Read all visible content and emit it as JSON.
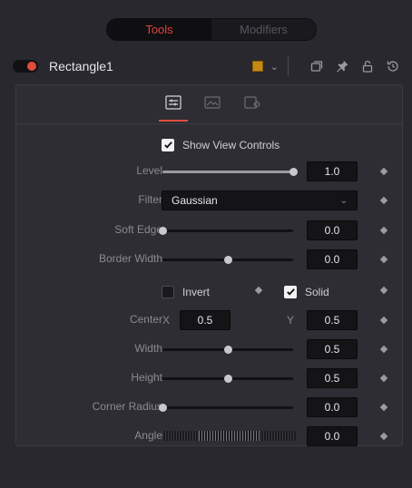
{
  "tabs": {
    "tools": "Tools",
    "modifiers": "Modifiers"
  },
  "tool": {
    "name": "Rectangle1",
    "color": "#c58a14"
  },
  "icons": {
    "header": [
      "copy-icon",
      "pin-icon",
      "lock-icon",
      "reset-icon"
    ],
    "subtabs": [
      "controls-icon",
      "image-icon",
      "settings-icon"
    ]
  },
  "controls": {
    "show_view_controls": "Show View Controls",
    "level": {
      "label": "Level",
      "value": "1.0",
      "fraction": 1.0
    },
    "filter": {
      "label": "Filter",
      "value": "Gaussian"
    },
    "soft_edge": {
      "label": "Soft Edge",
      "value": "0.0",
      "fraction": 0.0
    },
    "border_width": {
      "label": "Border Width",
      "value": "0.0",
      "fraction": 0.5
    },
    "invert": "Invert",
    "solid": "Solid",
    "center": {
      "label": "Center",
      "x_label": "X",
      "x_value": "0.5",
      "y_label": "Y",
      "y_value": "0.5"
    },
    "width": {
      "label": "Width",
      "value": "0.5",
      "fraction": 0.5
    },
    "height": {
      "label": "Height",
      "value": "0.5",
      "fraction": 0.5
    },
    "corner_radius": {
      "label": "Corner Radius",
      "value": "0.0",
      "fraction": 0.0
    },
    "angle": {
      "label": "Angle",
      "value": "0.0"
    }
  }
}
